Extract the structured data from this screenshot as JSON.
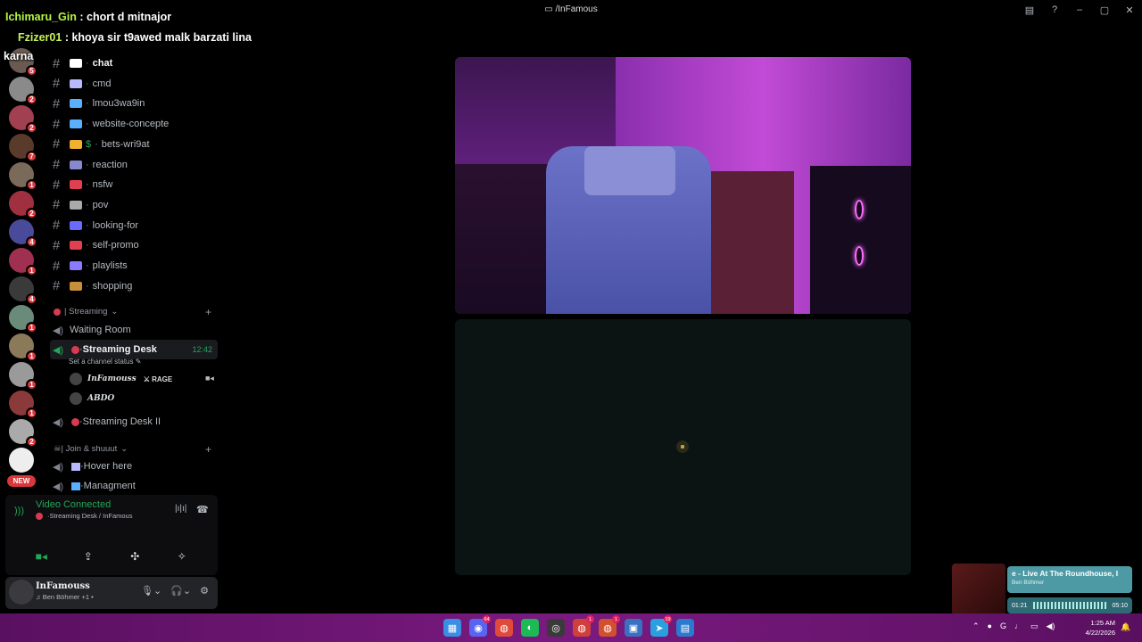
{
  "window": {
    "title": "/InFamous",
    "controls": [
      "inbox",
      "help",
      "minimize",
      "maximize",
      "close"
    ]
  },
  "overlay": {
    "messages": [
      {
        "user": "Ichimaru_Gin",
        "text": " : chort d mitnajor"
      },
      {
        "user": "Fzizer01",
        "text": " : khoya sir t9awed malk barzati lina"
      },
      {
        "user": "",
        "text": "karna"
      }
    ],
    "colors": {
      "username": "#b7f542"
    }
  },
  "servers": [
    {
      "badge": "5",
      "color": "#6a5a52"
    },
    {
      "badge": "2",
      "color": "#8a8a8a"
    },
    {
      "badge": "2",
      "color": "#a04050"
    },
    {
      "badge": "7",
      "color": "#5a3a2a"
    },
    {
      "badge": "1",
      "color": "#7a6a5a"
    },
    {
      "badge": "2",
      "color": "#a03040"
    },
    {
      "badge": "4",
      "color": "#4a4a9a"
    },
    {
      "badge": "1",
      "color": "#a03050"
    },
    {
      "badge": "4",
      "color": "#3a3a3a"
    },
    {
      "badge": "1",
      "color": "#6a8a7a"
    },
    {
      "badge": "1",
      "color": "#8a7a5a"
    },
    {
      "badge": "1",
      "color": "#9a9a9a"
    },
    {
      "badge": "1",
      "color": "#8a3a3a"
    },
    {
      "badge": "2",
      "color": "#aaaaaa"
    },
    {
      "badge": "",
      "color": "#eeeeee"
    }
  ],
  "new_badge": "NEW",
  "channels": {
    "text": [
      {
        "name": "chat",
        "emoji_color": "#ffffff",
        "active": true
      },
      {
        "name": "cmd",
        "emoji_color": "#b9b9ff"
      },
      {
        "name": "lmou3wa9in",
        "emoji_color": "#5ab0ff"
      },
      {
        "name": "website-concepte",
        "emoji_color": "#5ab0ff"
      },
      {
        "name": "bets-wri9at",
        "emoji_color": "#f0b030",
        "prefix": "$"
      },
      {
        "name": "reaction",
        "emoji_color": "#8888cc"
      },
      {
        "name": "nsfw",
        "emoji_color": "#e04050"
      },
      {
        "name": "pov",
        "emoji_color": "#aaaaaa"
      },
      {
        "name": "looking-for",
        "emoji_color": "#6a6aff"
      },
      {
        "name": "self-promo",
        "emoji_color": "#e04050"
      },
      {
        "name": "playlists",
        "emoji_color": "#8a7aff"
      },
      {
        "name": "shopping",
        "emoji_color": "#c8903a"
      }
    ],
    "streaming_category": "| Streaming",
    "waiting_room": "Waiting Room",
    "streaming_desk": "Streaming Desk",
    "streaming_desk_time": "12:42",
    "status_placeholder": "Set a channel status",
    "members": [
      {
        "name": "InFamouss",
        "tag": "RAGE"
      },
      {
        "name": "ABDO",
        "tag": ""
      }
    ],
    "streaming_desk_2": "Streaming Desk II",
    "join_category": "| Join & shuuut",
    "hover_here": "Hover here",
    "managment": "Managment"
  },
  "voice_panel": {
    "title": "Video Connected",
    "subtitle": "Streaming Desk / InFamous"
  },
  "user_panel": {
    "name": "InFamouss",
    "activity": "Ben Böhmer +1"
  },
  "media": {
    "song": "e - Live At The Roundhouse, I",
    "artist": "Ben Böhmer",
    "elapsed": "01:21",
    "duration": "05:10",
    "progress": 0.26
  },
  "taskbar": {
    "apps": [
      {
        "name": "start",
        "glyph": "▦",
        "color": "#3a8ee6"
      },
      {
        "name": "discord",
        "glyph": "◉",
        "color": "#5865f2",
        "badge": "64"
      },
      {
        "name": "chrome",
        "glyph": "◍",
        "color": "#e04a3a"
      },
      {
        "name": "spotify",
        "glyph": "◐",
        "color": "#1db954"
      },
      {
        "name": "obs",
        "glyph": "◎",
        "color": "#3a3a3a"
      },
      {
        "name": "chrome-2",
        "glyph": "◍",
        "color": "#d0403a",
        "badge": "1"
      },
      {
        "name": "chrome-3",
        "glyph": "◍",
        "color": "#d05030",
        "badge": "1"
      },
      {
        "name": "remote",
        "glyph": "▣",
        "color": "#3a70c0"
      },
      {
        "name": "telegram",
        "glyph": "➤",
        "color": "#2aa0e0",
        "badge": "19"
      },
      {
        "name": "audio",
        "glyph": "▤",
        "color": "#2a7ad0"
      }
    ],
    "time": "1:25 AM",
    "date": "4/22/2026"
  }
}
